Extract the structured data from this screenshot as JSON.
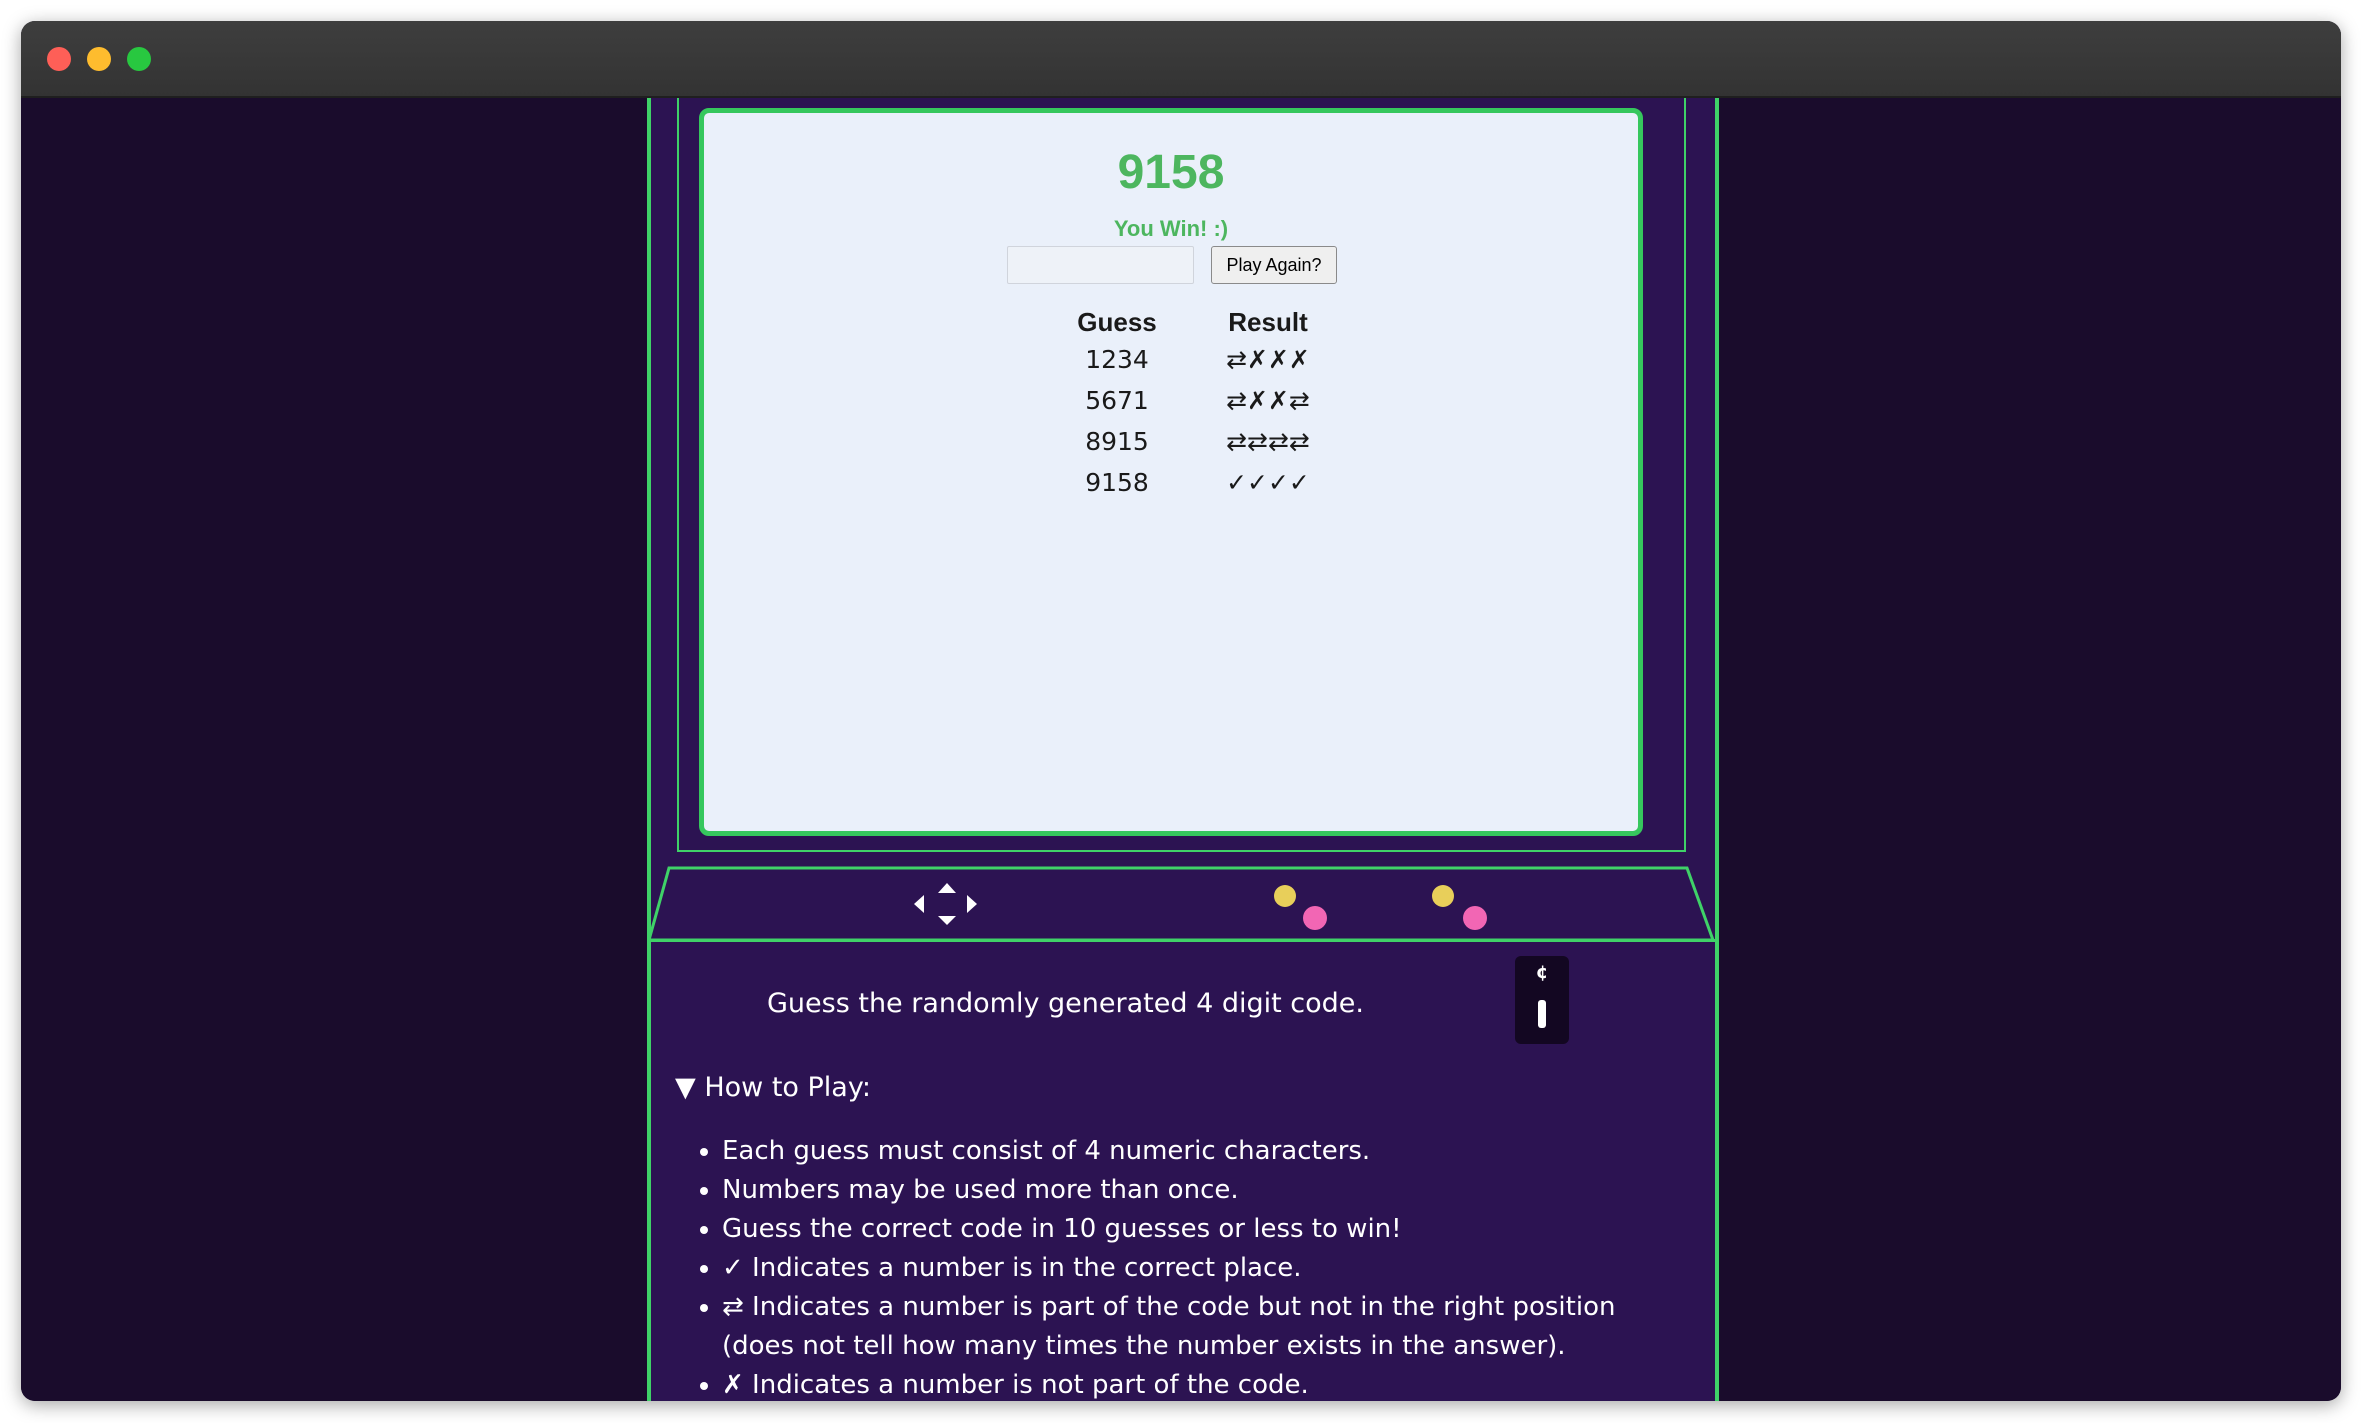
{
  "window": {
    "controls": [
      "close",
      "minimize",
      "maximize"
    ]
  },
  "game": {
    "answer": "9158",
    "status": "You Win! :)",
    "guess_input": {
      "value": "",
      "placeholder": ""
    },
    "play_again_label": "Play Again?",
    "table": {
      "headers": [
        "Guess",
        "Result"
      ],
      "rows": [
        {
          "guess": "1234",
          "result": "⇄✗✗✗"
        },
        {
          "guess": "5671",
          "result": "⇄✗✗⇄"
        },
        {
          "guess": "8915",
          "result": "⇄⇄⇄⇄"
        },
        {
          "guess": "9158",
          "result": "✓✓✓✓"
        }
      ]
    }
  },
  "instructions": {
    "intro": "Guess the randomly generated 4 digit code.",
    "coin_symbol": "¢",
    "summary": "▼ How to Play:",
    "rules": [
      "Each guess must consist of 4 numeric characters.",
      "Numbers may be used more than once.",
      "Guess the correct code in 10 guesses or less to win!",
      "✓ Indicates a number is in the correct place.",
      "⇄ Indicates a number is part of the code but not in the right position (does not tell how many times the number exists in the answer).",
      "✗ Indicates a number is not part of the code."
    ]
  },
  "colors": {
    "background": "#1a0c2c",
    "cabinet": "#2c1352",
    "neon_green": "#3fd268",
    "screen": "#eaf0fa",
    "win_text": "#4db65f",
    "button_yellow": "#e8cf5a",
    "button_pink": "#f266b4"
  },
  "icons": {
    "joystick": "dpad-arrows-icon",
    "buttons": [
      "yellow-button-icon",
      "pink-button-icon"
    ]
  }
}
